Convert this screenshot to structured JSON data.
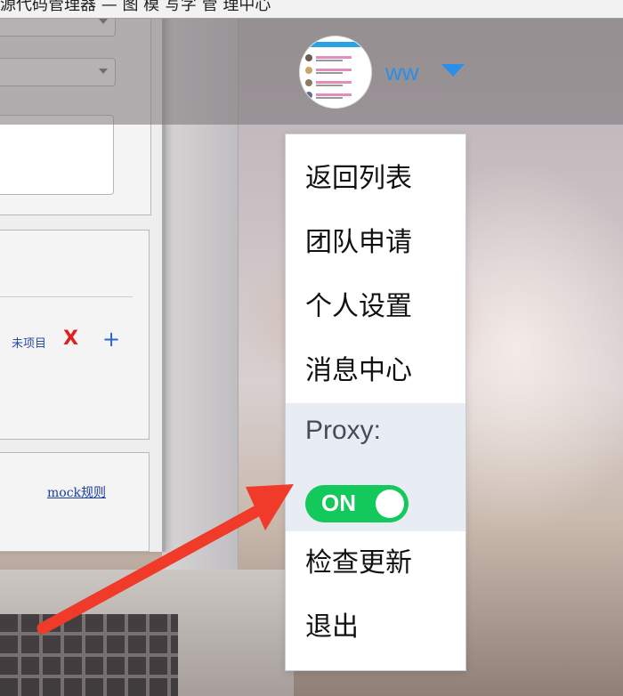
{
  "title_strip": {
    "text": "源代码管理器 — 图 模 写字 管 理中心"
  },
  "left_panel": {
    "status_text": "未项目",
    "remove_glyph": "X",
    "add_glyph": "+",
    "mock_link": "mock规则"
  },
  "header": {
    "username": "ww",
    "dropdown_caret": "caret-down-icon",
    "accent_color": "#2a8fe8"
  },
  "menu": {
    "items": [
      {
        "label": "返回列表"
      },
      {
        "label": "团队申请"
      },
      {
        "label": "个人设置"
      },
      {
        "label": "消息中心"
      }
    ],
    "proxy": {
      "label": "Proxy:",
      "toggle_label": "ON",
      "enabled": true,
      "toggle_color": "#14c95c"
    },
    "bottom_items": [
      {
        "label": "检查更新"
      },
      {
        "label": "退出"
      }
    ]
  },
  "annotation": {
    "arrow_color": "#f03a2a"
  }
}
